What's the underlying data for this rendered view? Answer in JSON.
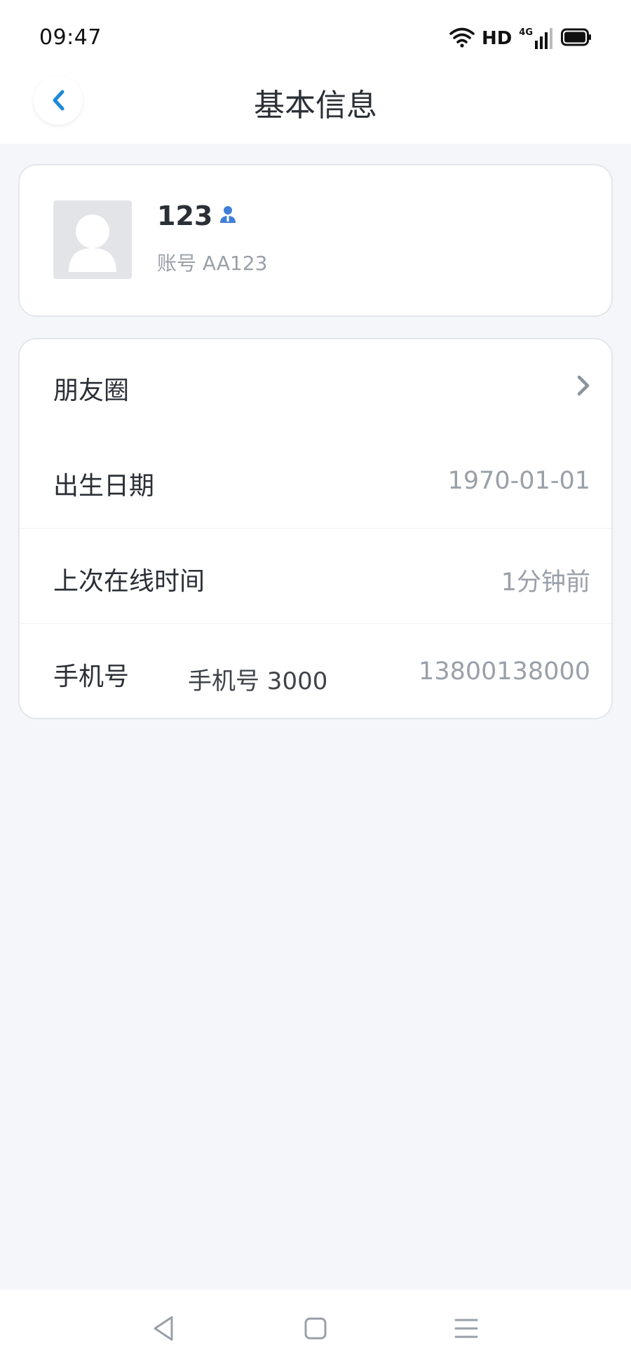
{
  "status_bar": {
    "time": "09:47",
    "network_label": "HD",
    "cell_label": "4G"
  },
  "header": {
    "title": "基本信息"
  },
  "profile": {
    "name": "123",
    "account": "账号 AA123"
  },
  "info_rows": [
    {
      "label": "朋友圈",
      "value": ""
    },
    {
      "label": "出生日期",
      "value": "1970-01-01"
    },
    {
      "label": "上次在线时间",
      "value": "1分钟前"
    },
    {
      "label": "手机号",
      "value": "13800138000",
      "overlay_text": "手机号 3000"
    }
  ],
  "icons": {
    "back": "chevron-left-icon",
    "user_badge": "user-badge-icon",
    "friends_arrow": "chevron-right-icon",
    "nav_back": "triangle-back-icon",
    "nav_home": "square-home-icon",
    "nav_menu": "menu-lines-icon"
  },
  "colors": {
    "accent": "#1e88d8",
    "background": "#f4f6fa",
    "muted_text": "#9aa0a8"
  }
}
